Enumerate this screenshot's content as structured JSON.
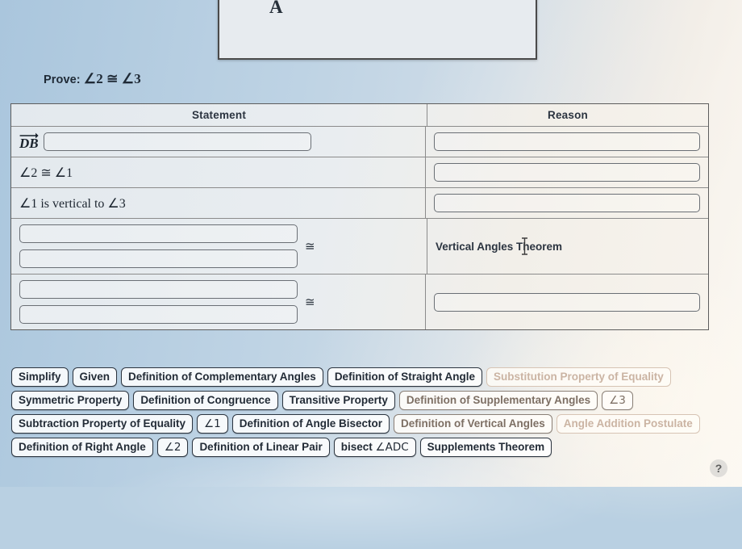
{
  "diagram": {
    "point_label": "A",
    "arrow_count": 2
  },
  "prove": {
    "label": "Prove:",
    "statement": "∠2 ≅ ∠3"
  },
  "table": {
    "headers": {
      "statement": "Statement",
      "reason": "Reason"
    },
    "rows": [
      {
        "statement_prefix": "DB",
        "statement_prefix_type": "ray",
        "statement_blank": true,
        "reason_blank": true
      },
      {
        "statement_text": "∠2 ≅ ∠1",
        "reason_blank": true
      },
      {
        "statement_text": "∠1 is vertical to ∠3",
        "reason_blank": true
      },
      {
        "statement_blanks": 2,
        "statement_congruence": "≅",
        "reason_text": "Vertical Angles Theorem"
      },
      {
        "statement_blanks": 2,
        "statement_congruence": "≅",
        "reason_blank": true
      }
    ]
  },
  "answer_bank": {
    "rows": [
      [
        {
          "label": "Simplify",
          "state": "available"
        },
        {
          "label": "Given",
          "state": "available"
        },
        {
          "label": "Definition of Complementary Angles",
          "state": "available"
        },
        {
          "label": "Definition of Straight Angle",
          "state": "available"
        },
        {
          "label": "Substitution Property of Equality",
          "state": "used"
        }
      ],
      [
        {
          "label": "Symmetric Property",
          "state": "available"
        },
        {
          "label": "Definition of Congruence",
          "state": "available"
        },
        {
          "label": "Transitive Property",
          "state": "available"
        },
        {
          "label": "Definition of Supplementary Angles",
          "state": "dim"
        },
        {
          "label": "∠3",
          "state": "dim"
        }
      ],
      [
        {
          "label": "Subtraction Property of Equality",
          "state": "available"
        },
        {
          "label": "∠1",
          "state": "available"
        },
        {
          "label": "Definition of Angle Bisector",
          "state": "available"
        },
        {
          "label": "Definition of Vertical Angles",
          "state": "dim"
        },
        {
          "label": "Angle Addition Postulate",
          "state": "used"
        }
      ],
      [
        {
          "label": "Definition of Right Angle",
          "state": "available"
        },
        {
          "label": "∠2",
          "state": "available"
        },
        {
          "label": "Definition of Linear Pair",
          "state": "available"
        },
        {
          "label": "bisect ∠ADC",
          "state": "available"
        },
        {
          "label": "Supplements Theorem",
          "state": "available"
        }
      ]
    ]
  },
  "help": {
    "label": "?"
  },
  "colors": {
    "background": "#b9d0e2",
    "table_border": "#5d5d5d",
    "chip_border": "#2c3540",
    "chip_faded": "#cbb4a3"
  }
}
